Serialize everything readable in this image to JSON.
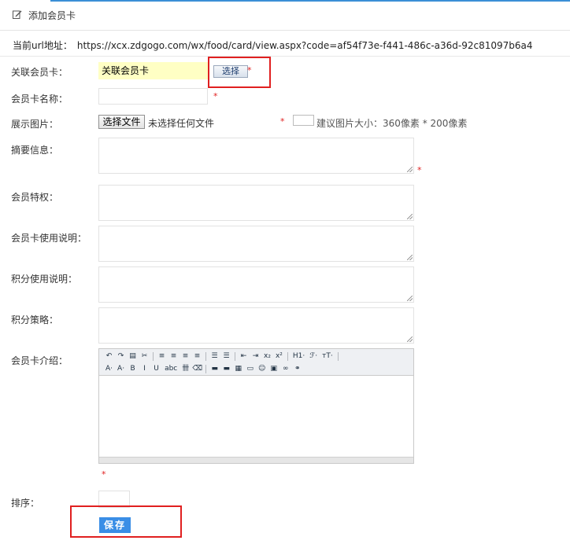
{
  "header": {
    "title": "添加会员卡",
    "icon": "edit-icon"
  },
  "url": {
    "label": "当前url地址：",
    "value": "https://xcx.zdgogo.com/wx/food/card/view.aspx?code=af54f73e-f441-486c-a36d-92c81097b6a4"
  },
  "fields": {
    "linked_card": {
      "label": "关联会员卡：",
      "value": "关联会员卡",
      "select_label": "选择"
    },
    "card_name": {
      "label": "会员卡名称：",
      "value": ""
    },
    "image": {
      "label": "展示图片：",
      "file_button": "选择文件",
      "file_status": "未选择任何文件",
      "hint": "建议图片大小：360像素 * 200像素"
    },
    "summary": {
      "label": "摘要信息："
    },
    "privilege": {
      "label": "会员特权："
    },
    "card_usage": {
      "label": "会员卡使用说明："
    },
    "points_usage": {
      "label": "积分使用说明："
    },
    "points_policy": {
      "label": "积分策略："
    },
    "intro": {
      "label": "会员卡介绍："
    },
    "sort": {
      "label": "排序：",
      "value": ""
    }
  },
  "required_mark": "*",
  "editor": {
    "row1": [
      "↶",
      "↷",
      "▤",
      "✂",
      "|",
      "≡",
      "≡",
      "≡",
      "≡",
      "|",
      "☰",
      "☰",
      "|",
      "⇤",
      "⇥",
      "x₂",
      "x²",
      "|",
      "H1·",
      "ℱ·",
      "тT·",
      "|"
    ],
    "row2": [
      "A·",
      "A·",
      "B",
      "I",
      "U",
      "abc",
      "卌",
      "⌫",
      "|",
      "▬",
      "▬",
      "▦",
      "▭",
      "☺",
      "▣",
      "∞",
      "⚭"
    ]
  },
  "save_label": "保存",
  "colors": {
    "accent": "#3a8ee6",
    "required": "#e02020",
    "highlight_input": "#ffffc4",
    "annotation_box": "#e02020"
  }
}
